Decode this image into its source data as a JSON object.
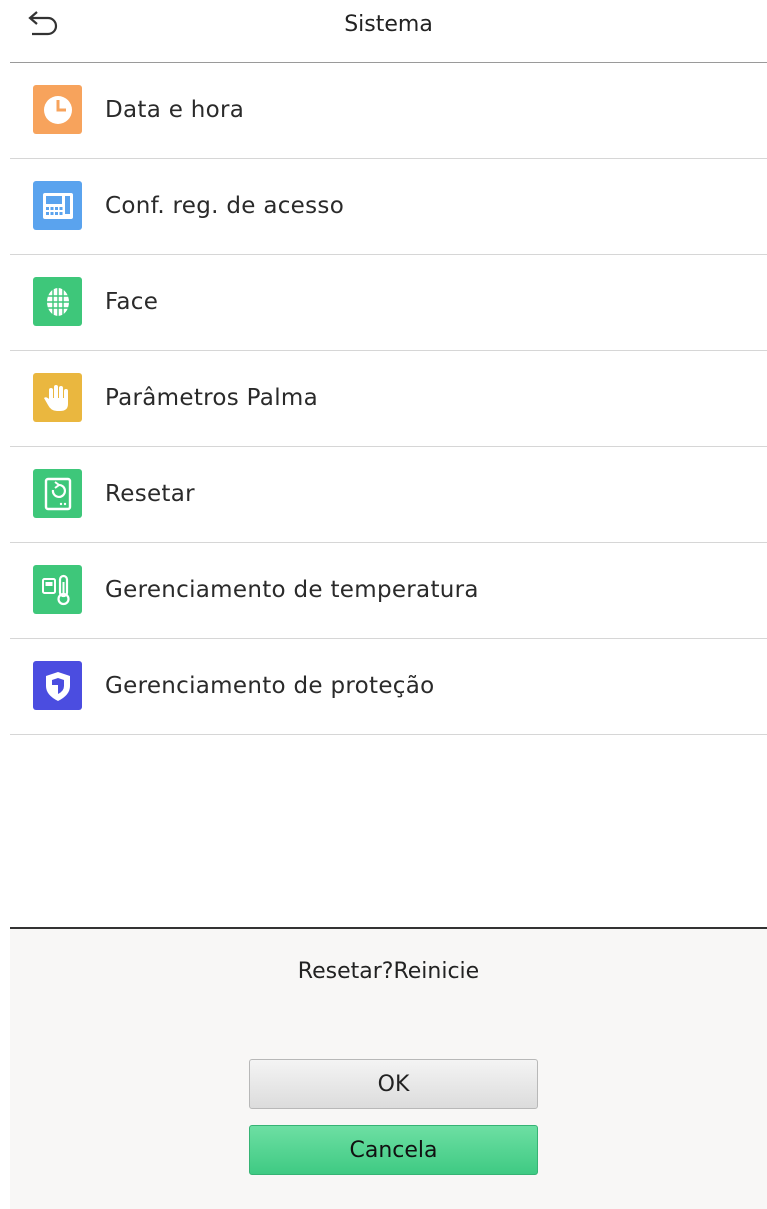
{
  "header": {
    "title": "Sistema",
    "back_icon": "back-arrow-icon"
  },
  "menu": [
    {
      "label": "Data e hora",
      "icon": "clock-icon",
      "color": "#f7a35c"
    },
    {
      "label": "Conf. reg. de acesso",
      "icon": "access-terminal-icon",
      "color": "#5aa3ee"
    },
    {
      "label": "Face",
      "icon": "face-scan-icon",
      "color": "#3ec77a"
    },
    {
      "label": "Parâmetros Palma",
      "icon": "palm-icon",
      "color": "#eab73f"
    },
    {
      "label": "Resetar",
      "icon": "reset-device-icon",
      "color": "#3ec77a"
    },
    {
      "label": "Gerenciamento de temperatura",
      "icon": "thermometer-icon",
      "color": "#3ec77a"
    },
    {
      "label": "Gerenciamento de proteção",
      "icon": "shield-icon",
      "color": "#4b4de0"
    }
  ],
  "dialog": {
    "message": "Resetar?Reinicie",
    "ok_label": "OK",
    "cancel_label": "Cancela"
  }
}
